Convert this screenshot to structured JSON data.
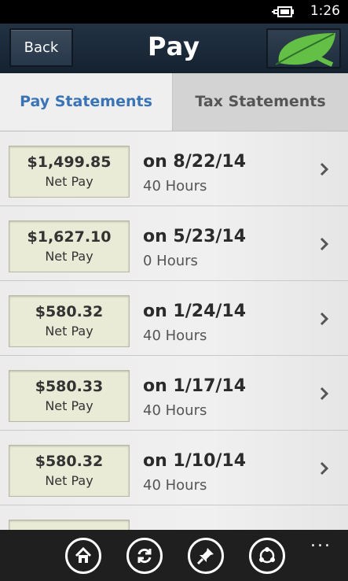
{
  "status": {
    "time": "1:26",
    "battery_icon": "battery-charging-icon"
  },
  "header": {
    "back_label": "Back",
    "title": "Pay",
    "logo_icon": "leaf-icon",
    "logo_color": "#6cc04a"
  },
  "tabs": [
    {
      "label": "Pay Statements",
      "active": true
    },
    {
      "label": "Tax Statements",
      "active": false
    }
  ],
  "statements": [
    {
      "amount": "$1,499.85",
      "amount_label": "Net Pay",
      "date": "on 8/22/14",
      "hours": "40 Hours"
    },
    {
      "amount": "$1,627.10",
      "amount_label": "Net Pay",
      "date": "on 5/23/14",
      "hours": "0 Hours"
    },
    {
      "amount": "$580.32",
      "amount_label": "Net Pay",
      "date": "on 1/24/14",
      "hours": "40 Hours"
    },
    {
      "amount": "$580.33",
      "amount_label": "Net Pay",
      "date": "on 1/17/14",
      "hours": "40 Hours"
    },
    {
      "amount": "$580.32",
      "amount_label": "Net Pay",
      "date": "on 1/10/14",
      "hours": "40 Hours"
    },
    {
      "amount": "",
      "amount_label": "",
      "date": "",
      "hours": ""
    }
  ],
  "appbar": {
    "buttons": [
      "home-icon",
      "refresh-icon",
      "pin-icon",
      "share-icon"
    ],
    "more": "..."
  },
  "colors": {
    "accent_tab": "#3a73b6",
    "header_bg": "#1c2b3a",
    "amount_box": "#e9ebd6"
  }
}
